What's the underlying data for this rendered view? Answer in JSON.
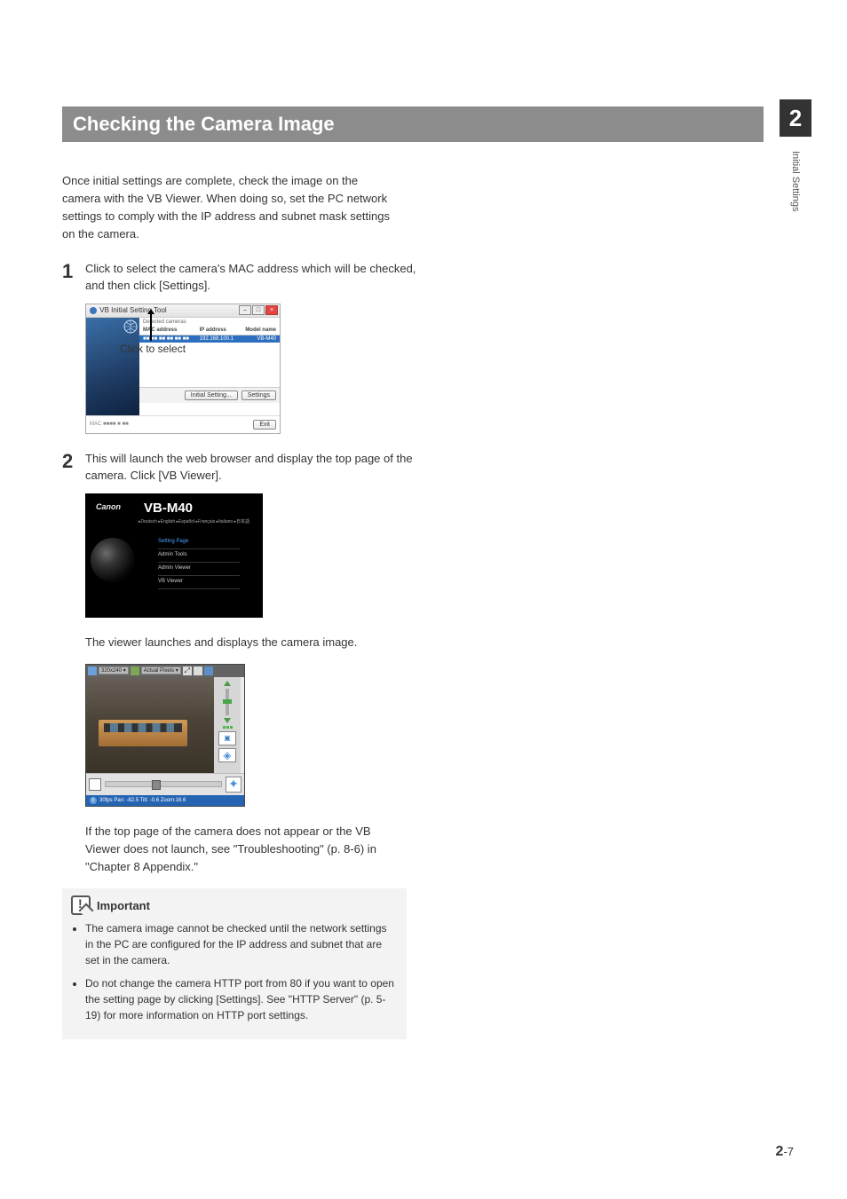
{
  "chapter_number": "2",
  "side_label": "Initial Settings",
  "title": "Checking the Camera Image",
  "intro": "Once initial settings are complete, check the image on the camera with the VB Viewer. When doing so, set the PC network settings to comply with the IP address and subnet mask settings on the camera.",
  "steps": {
    "s1_num": "1",
    "s1_text": "Click to select the camera's MAC address which will be checked, and then click [Settings].",
    "s2_num": "2",
    "s2_text": "This will launch the web browser and display the top page of the camera. Click [VB Viewer]."
  },
  "fig1": {
    "window_title": "VB Initial Setting Tool",
    "list_header": "Detected cameras",
    "col_mac": "MAC address",
    "col_ip": "IP address",
    "col_model": "Model name",
    "row_mac": "■■ ■■ ■■ ■■ ■■ ■■",
    "row_ip": "192.168.100.1",
    "row_model": "VB-M40",
    "annot": "Click to select",
    "btn_save": "Initial Setting...",
    "btn_settings": "Settings",
    "btn_exit": "Exit",
    "footer_mac": "MAC ■■■■ ■ ■■"
  },
  "fig2": {
    "brand": "Canon",
    "model": "VB-M40",
    "langs": "▸Deutsch  ▸English  ▸Español  ▸Français  ▸Italiano  ▸日本語",
    "menu1": "Setting Page",
    "menu2": "Admin Tools",
    "menu3": "Admin Viewer",
    "menu4": "VB Viewer"
  },
  "after_fig2": "The viewer launches and displays the camera image.",
  "fig3": {
    "res": "320x240",
    "scale": "Actual Pixels",
    "status": "30fps Pan: -82.5 Tilt: -0.6 Zoom:16.6"
  },
  "after_fig3": "If the top page of the camera does not appear or the VB Viewer does not launch, see \"Troubleshooting\" (p. 8-6) in \"Chapter 8 Appendix.\"",
  "important": {
    "heading": "Important",
    "b1": "The camera image cannot be checked until the network settings in the PC are configured for the IP address and subnet that are set in the camera.",
    "b2": "Do not change the camera HTTP port from 80 if you want to open the setting page by clicking [Settings]. See \"HTTP Server\" (p. 5-19) for more information on HTTP port settings."
  },
  "page_number_prefix": "2",
  "page_number_suffix": "-7"
}
